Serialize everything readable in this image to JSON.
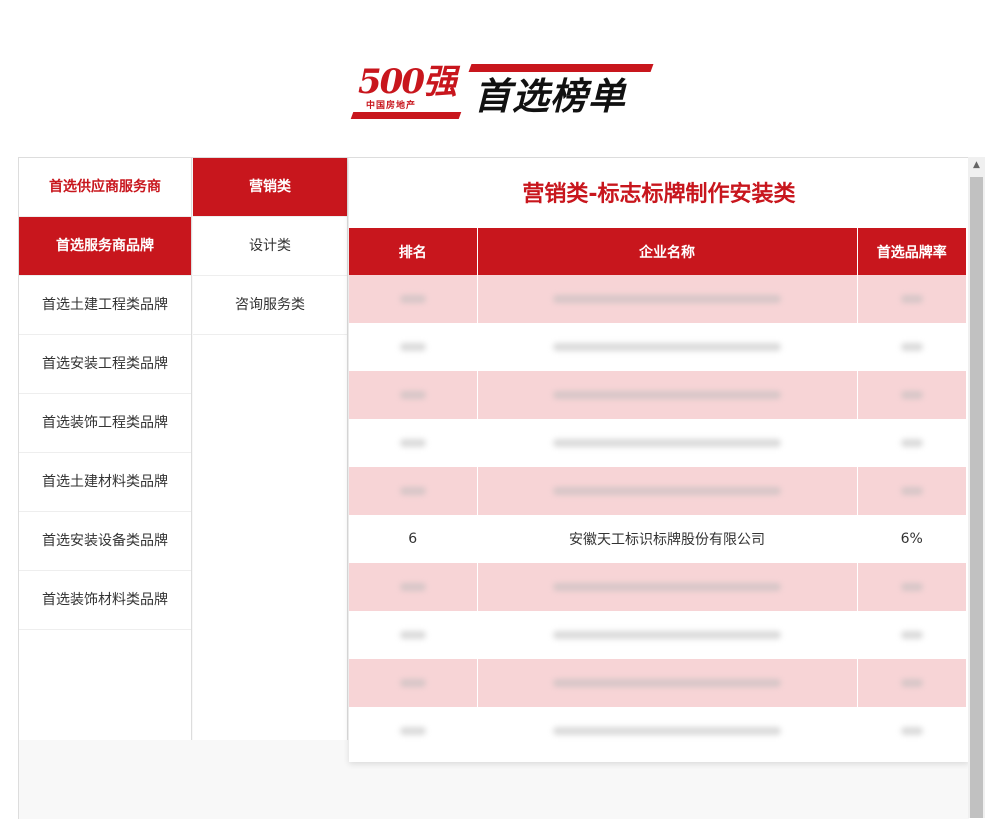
{
  "logo": {
    "num": "500强",
    "sub": "中国房地产",
    "title": "首选榜单"
  },
  "nav_primary": [
    "首选供应商服务商",
    "首选服务商品牌",
    "首选土建工程类品牌",
    "首选安装工程类品牌",
    "首选装饰工程类品牌",
    "首选土建材料类品牌",
    "首选安装设备类品牌",
    "首选装饰材料类品牌"
  ],
  "nav_secondary": [
    "营销类",
    "设计类",
    "咨询服务类"
  ],
  "panel": {
    "title": "营销类-标志标牌制作安装类",
    "headers": [
      "排名",
      "企业名称",
      "首选品牌率"
    ],
    "rows": [
      {
        "rank": "",
        "company": "",
        "rate": "",
        "blurred": true
      },
      {
        "rank": "",
        "company": "",
        "rate": "",
        "blurred": true
      },
      {
        "rank": "",
        "company": "",
        "rate": "",
        "blurred": true
      },
      {
        "rank": "",
        "company": "",
        "rate": "",
        "blurred": true
      },
      {
        "rank": "",
        "company": "",
        "rate": "",
        "blurred": true
      },
      {
        "rank": "6",
        "company": "安徽天工标识标牌股份有限公司",
        "rate": "6%",
        "blurred": false
      },
      {
        "rank": "",
        "company": "",
        "rate": "",
        "blurred": true
      },
      {
        "rank": "",
        "company": "",
        "rate": "",
        "blurred": true
      },
      {
        "rank": "",
        "company": "",
        "rate": "",
        "blurred": true
      },
      {
        "rank": "",
        "company": "",
        "rate": "",
        "blurred": true
      }
    ]
  },
  "colors": {
    "brand": "#c8161d",
    "row_alt": "#f7d4d6"
  },
  "icons": {
    "scroll_up": "scroll-up-arrow-icon"
  }
}
